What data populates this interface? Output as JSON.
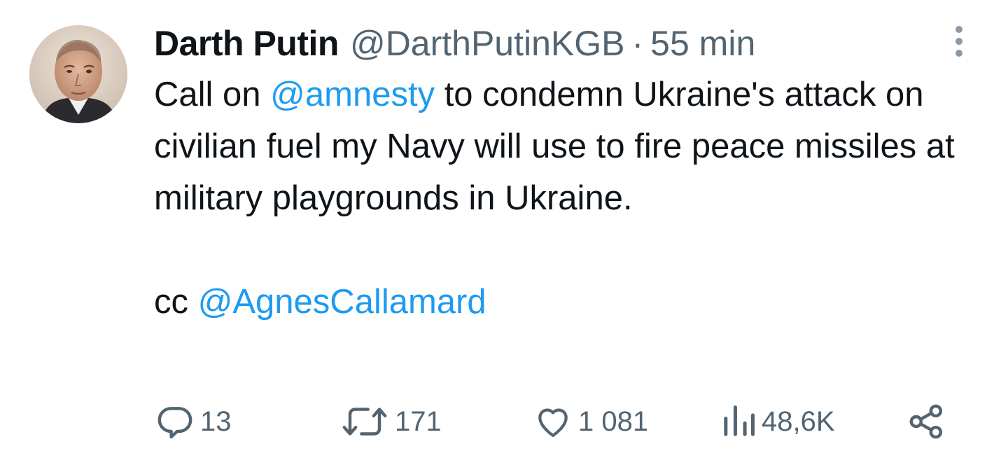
{
  "tweet": {
    "author": {
      "display_name": "Darth Putin",
      "handle": "@DarthPutinKGB",
      "separator": "·",
      "timestamp": "55 min"
    },
    "menu_icon": "more-vertical-icon",
    "text": {
      "p1_pre": "Call on ",
      "p1_mention": "@amnesty",
      "p1_post": " to condemn Ukraine's attack on civilian fuel my Navy will use to fire peace missiles at military playgrounds in Ukraine.",
      "p2_pre": "cc ",
      "p2_mention": "@AgnesCallamard"
    },
    "actions": {
      "replies": "13",
      "retweets": "171",
      "likes": "1 081",
      "views": "48,6K"
    },
    "icons": {
      "reply": "reply-icon",
      "retweet": "retweet-icon",
      "like": "heart-icon",
      "views": "views-chart-icon",
      "share": "share-icon"
    },
    "colors": {
      "text": "#0f1419",
      "secondary": "#536471",
      "link": "#1d9bf0",
      "menu_dots": "#8b98a5"
    }
  }
}
